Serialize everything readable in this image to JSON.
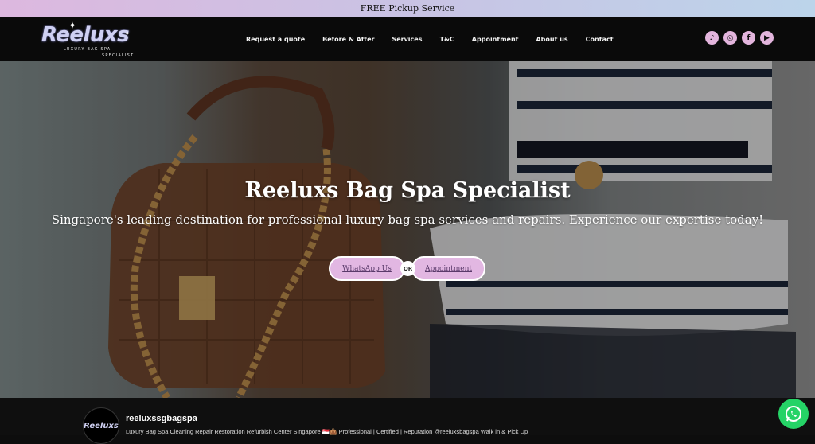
{
  "topbar": {
    "text": "FREE Pickup Service"
  },
  "logo": {
    "word": "Reeluxs",
    "sub1": "LUXURY BAG SPA",
    "sub2": "SPECIALIST"
  },
  "nav": {
    "items": [
      "Request a quote",
      "Before & After",
      "Services",
      "T&C",
      "Appointment",
      "About us",
      "Contact"
    ]
  },
  "socials": [
    {
      "icon": "tiktok-icon",
      "glyph": "♪"
    },
    {
      "icon": "instagram-icon",
      "glyph": "◎"
    },
    {
      "icon": "facebook-icon",
      "glyph": "f"
    },
    {
      "icon": "youtube-icon",
      "glyph": "▶"
    }
  ],
  "hero": {
    "title": "Reeluxs Bag Spa Specialist",
    "subtitle": "Singapore's leading destination for professional luxury bag spa services and repairs. Experience our expertise today!",
    "whatsapp_label": "WhatsApp Us",
    "or_label": "OR",
    "appointment_label": "Appointment"
  },
  "profile": {
    "avatar_text": "Reeluxs",
    "handle": "reeluxssgbagspa",
    "bio": "Luxury Bag Spa Cleaning Repair Restoration Refurbish Center Singapore 🇸🇬👜 Professional | Certified | Reputation @reeluxsbagspa Walk in & Pick Up"
  },
  "colors": {
    "accent": "#e2b7e2",
    "whatsapp": "#25d366",
    "nav_bg": "#0a0a0a"
  }
}
